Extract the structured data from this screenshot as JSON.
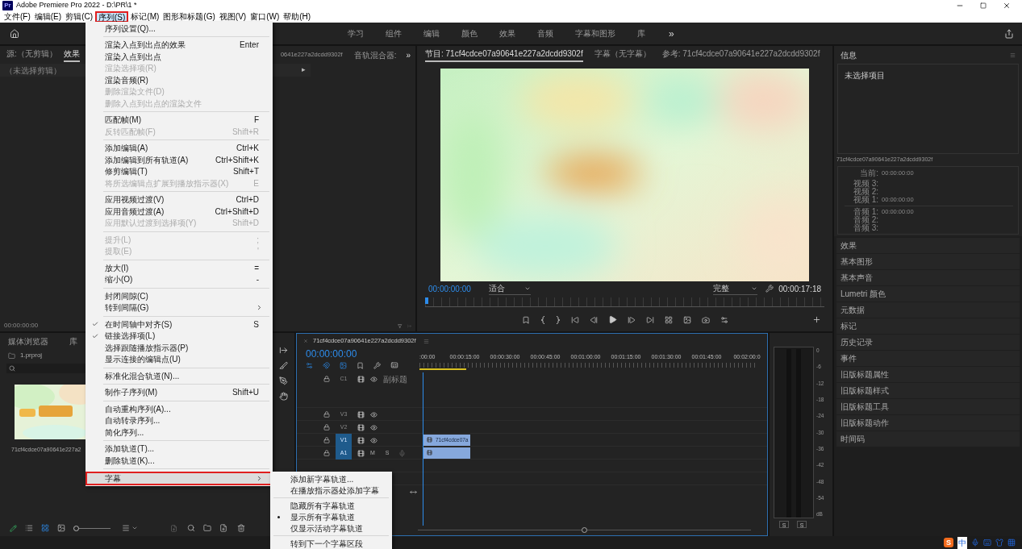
{
  "title_bar": {
    "app_icon": "Pr",
    "title": "Adobe Premiere Pro 2022 - D:\\PR\\1 *"
  },
  "menu_bar": [
    {
      "label": "文件(F)",
      "selected": false
    },
    {
      "label": "编辑(E)",
      "selected": false
    },
    {
      "label": "剪辑(C)",
      "selected": false
    },
    {
      "label": "序列(S)",
      "selected": true
    },
    {
      "label": "标记(M)",
      "selected": false
    },
    {
      "label": "图形和标题(G)",
      "selected": false
    },
    {
      "label": "视图(V)",
      "selected": false
    },
    {
      "label": "窗口(W)",
      "selected": false
    },
    {
      "label": "帮助(H)",
      "selected": false
    }
  ],
  "workspaces": {
    "tabs": [
      "学习",
      "组件",
      "编辑",
      "颜色",
      "效果",
      "音频",
      "字幕和图形",
      "库"
    ],
    "more": "»"
  },
  "source_panel": {
    "tabs": [
      {
        "label": "源:（无剪辑）",
        "selected": false
      },
      {
        "label": "效果",
        "selected": true
      }
    ],
    "hidden_tab_fragment": "0641e227a2dcdd9302f",
    "audio_mixer_tab": "音轨混合器:",
    "more": "»",
    "clip_status": "（未选择剪辑）",
    "expand_glyph": "▸",
    "timecode": "00:00:00:00"
  },
  "program_monitor": {
    "tabs": [
      {
        "label": "节目: 71cf4cdce07a90641e227a2dcdd9302f",
        "selected": true
      },
      {
        "label": "字幕（无字幕）",
        "selected": false
      },
      {
        "label": "参考: 71cf4cdce07a90641e227a2dcdd9302f",
        "selected": false
      }
    ],
    "timecode": "00:00:00:00",
    "fit": "适合",
    "quality": "完整",
    "duration": "00:00:17:18"
  },
  "project_panel": {
    "zoom_slider": {
      "level": 0
    },
    "tabs": [
      "媒体浏览器",
      "库"
    ],
    "project_file": "1.prproj",
    "clip_label": "71cf4cdce07a90641e227a2"
  },
  "timeline": {
    "sequence": "71cf4cdce07a90641e227a2dcdd9302f",
    "timecode": "00:00:00:00",
    "ruler": [
      ":00:00",
      "00:00:15:00",
      "00:00:30:00",
      "00:00:45:00",
      "00:01:00:00",
      "00:01:15:00",
      "00:01:30:00",
      "00:01:45:00",
      "00:02:00:0"
    ],
    "tracks": [
      {
        "kind": "caption",
        "label": "C1",
        "name": "副标题",
        "targeted": false,
        "has_clip": false
      },
      {
        "kind": "video",
        "label": "V3",
        "targeted": false,
        "has_clip": false
      },
      {
        "kind": "video",
        "label": "V2",
        "targeted": false,
        "has_clip": false
      },
      {
        "kind": "video",
        "label": "V1",
        "targeted": true,
        "has_clip": true,
        "clip_label": "71cf4cdce07a"
      },
      {
        "kind": "audio",
        "label": "A1",
        "targeted": true,
        "has_clip": true,
        "mute_label": "M",
        "solo_label": "S"
      }
    ]
  },
  "audio_meter": {
    "scale": [
      "0",
      "-6",
      "-12",
      "-18",
      "-24",
      "-30",
      "-36",
      "-42",
      "-48",
      "-54",
      "dB"
    ],
    "solo_buttons": [
      "S",
      "S"
    ]
  },
  "info_panel": {
    "tab": "信息",
    "selection": "未选择项目",
    "sequence": "71cf4cdce07a90641e227a2dcdd9302f",
    "current": {
      "label": "当前:",
      "value": "00:00:00:00"
    },
    "video_tracks": [
      {
        "label": "视频 3:"
      },
      {
        "label": "视频 2:"
      },
      {
        "label": "视频 1:",
        "value": "00:00:00:00"
      }
    ],
    "audio_tracks": [
      {
        "label": "音频 1:",
        "value": "00:00:00:00"
      },
      {
        "label": "音频 2:"
      },
      {
        "label": "音频 3:"
      }
    ]
  },
  "panels": [
    "效果",
    "基本图形",
    "基本声音",
    "Lumetri 颜色",
    "元数据",
    "标记",
    "历史记录",
    "事件",
    "旧版标题属性",
    "旧版标题样式",
    "旧版标题工具",
    "旧版标题动作",
    "时间码"
  ],
  "status_bar": {
    "ime_logo": "S",
    "ime_mode": "中"
  },
  "sequence_menu": {
    "items": [
      {
        "kind": "item",
        "label": "序列设置(Q)...",
        "disabled": false,
        "checked": false,
        "highlighted": false,
        "submenu": false
      },
      {
        "kind": "separator"
      },
      {
        "kind": "item",
        "label": "渲染入点到出点的效果",
        "shortcut": "Enter",
        "disabled": false,
        "checked": false,
        "highlighted": false,
        "submenu": false
      },
      {
        "kind": "item",
        "label": "渲染入点到出点",
        "disabled": false,
        "checked": false,
        "highlighted": false,
        "submenu": false
      },
      {
        "kind": "item",
        "label": "渲染选择项(R)",
        "disabled": true,
        "checked": false,
        "highlighted": false,
        "submenu": false
      },
      {
        "kind": "item",
        "label": "渲染音频(R)",
        "disabled": false,
        "checked": false,
        "highlighted": false,
        "submenu": false
      },
      {
        "kind": "item",
        "label": "删除渲染文件(D)",
        "disabled": true,
        "checked": false,
        "highlighted": false,
        "submenu": false
      },
      {
        "kind": "item",
        "label": "删除入点到出点的渲染文件",
        "disabled": true,
        "checked": false,
        "highlighted": false,
        "submenu": false
      },
      {
        "kind": "separator"
      },
      {
        "kind": "item",
        "label": "匹配帧(M)",
        "shortcut": "F",
        "disabled": false,
        "checked": false,
        "highlighted": false,
        "submenu": false
      },
      {
        "kind": "item",
        "label": "反转匹配帧(F)",
        "shortcut": "Shift+R",
        "disabled": true,
        "checked": false,
        "highlighted": false,
        "submenu": false
      },
      {
        "kind": "separator"
      },
      {
        "kind": "item",
        "label": "添加编辑(A)",
        "shortcut": "Ctrl+K",
        "disabled": false,
        "checked": false,
        "highlighted": false,
        "submenu": false
      },
      {
        "kind": "item",
        "label": "添加编辑到所有轨道(A)",
        "shortcut": "Ctrl+Shift+K",
        "disabled": false,
        "checked": false,
        "highlighted": false,
        "submenu": false
      },
      {
        "kind": "item",
        "label": "修剪编辑(T)",
        "shortcut": "Shift+T",
        "disabled": false,
        "checked": false,
        "highlighted": false,
        "submenu": false
      },
      {
        "kind": "item",
        "label": "将所选编辑点扩展到播放指示器(X)",
        "shortcut": "E",
        "disabled": true,
        "checked": false,
        "highlighted": false,
        "submenu": false
      },
      {
        "kind": "separator"
      },
      {
        "kind": "item",
        "label": "应用视频过渡(V)",
        "shortcut": "Ctrl+D",
        "disabled": false,
        "checked": false,
        "highlighted": false,
        "submenu": false
      },
      {
        "kind": "item",
        "label": "应用音频过渡(A)",
        "shortcut": "Ctrl+Shift+D",
        "disabled": false,
        "checked": false,
        "highlighted": false,
        "submenu": false
      },
      {
        "kind": "item",
        "label": "应用默认过渡到选择项(Y)",
        "shortcut": "Shift+D",
        "disabled": true,
        "checked": false,
        "highlighted": false,
        "submenu": false
      },
      {
        "kind": "separator"
      },
      {
        "kind": "item",
        "label": "提升(L)",
        "shortcut": ";",
        "disabled": true,
        "checked": false,
        "highlighted": false,
        "submenu": false
      },
      {
        "kind": "item",
        "label": "提取(E)",
        "shortcut": "'",
        "disabled": true,
        "checked": false,
        "highlighted": false,
        "submenu": false
      },
      {
        "kind": "separator"
      },
      {
        "kind": "item",
        "label": "放大(I)",
        "shortcut": "=",
        "disabled": false,
        "checked": false,
        "highlighted": false,
        "submenu": false
      },
      {
        "kind": "item",
        "label": "缩小(O)",
        "shortcut": "-",
        "disabled": false,
        "checked": false,
        "highlighted": false,
        "submenu": false
      },
      {
        "kind": "separator"
      },
      {
        "kind": "item",
        "label": "封闭间隙(C)",
        "disabled": false,
        "checked": false,
        "highlighted": false,
        "submenu": false
      },
      {
        "kind": "item",
        "label": "转到间隔(G)",
        "disabled": false,
        "checked": false,
        "highlighted": false,
        "submenu": true
      },
      {
        "kind": "separator"
      },
      {
        "kind": "item",
        "label": "在时间轴中对齐(S)",
        "shortcut": "S",
        "disabled": false,
        "checked": true,
        "highlighted": false,
        "submenu": false
      },
      {
        "kind": "item",
        "label": "链接选择项(L)",
        "disabled": false,
        "checked": true,
        "highlighted": false,
        "submenu": false
      },
      {
        "kind": "item",
        "label": "选择跟随播放指示器(P)",
        "disabled": false,
        "checked": false,
        "highlighted": false,
        "submenu": false
      },
      {
        "kind": "item",
        "label": "显示连接的编辑点(U)",
        "disabled": false,
        "checked": false,
        "highlighted": false,
        "submenu": false
      },
      {
        "kind": "separator"
      },
      {
        "kind": "item",
        "label": "标准化混合轨道(N)...",
        "disabled": false,
        "checked": false,
        "highlighted": false,
        "submenu": false
      },
      {
        "kind": "separator"
      },
      {
        "kind": "item",
        "label": "制作子序列(M)",
        "shortcut": "Shift+U",
        "disabled": false,
        "checked": false,
        "highlighted": false,
        "submenu": false
      },
      {
        "kind": "separator"
      },
      {
        "kind": "item",
        "label": "自动重构序列(A)...",
        "disabled": false,
        "checked": false,
        "highlighted": false,
        "submenu": false
      },
      {
        "kind": "item",
        "label": "自动转录序列...",
        "disabled": false,
        "checked": false,
        "highlighted": false,
        "submenu": false
      },
      {
        "kind": "item",
        "label": "简化序列...",
        "disabled": false,
        "checked": false,
        "highlighted": false,
        "submenu": false
      },
      {
        "kind": "separator"
      },
      {
        "kind": "item",
        "label": "添加轨道(T)...",
        "disabled": false,
        "checked": false,
        "highlighted": false,
        "submenu": false
      },
      {
        "kind": "item",
        "label": "删除轨道(K)...",
        "disabled": false,
        "checked": false,
        "highlighted": false,
        "submenu": false
      },
      {
        "kind": "separator"
      },
      {
        "kind": "item",
        "label": "字幕",
        "disabled": false,
        "checked": false,
        "highlighted": true,
        "submenu": true
      }
    ]
  },
  "caption_submenu": {
    "items": [
      {
        "kind": "item",
        "label": "添加新字幕轨道...",
        "checked": false
      },
      {
        "kind": "item",
        "label": "在播放指示器处添加字幕",
        "checked": false
      },
      {
        "kind": "separator"
      },
      {
        "kind": "item",
        "label": "隐藏所有字幕轨道",
        "checked": false
      },
      {
        "kind": "item",
        "label": "显示所有字幕轨道",
        "checked": true
      },
      {
        "kind": "item",
        "label": "仅显示活动字幕轨道",
        "checked": false
      },
      {
        "kind": "separator"
      },
      {
        "kind": "item",
        "label": "转到下一个字幕区段",
        "checked": false
      }
    ]
  }
}
